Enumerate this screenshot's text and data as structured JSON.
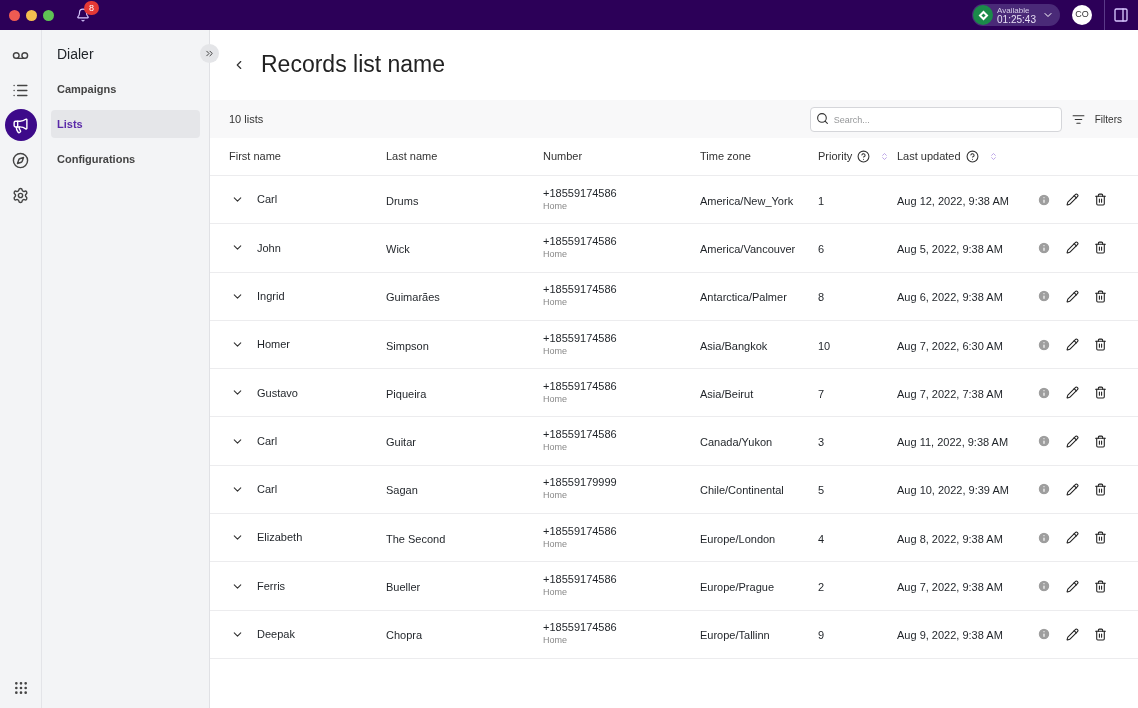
{
  "topbar": {
    "notifications": "8",
    "status": {
      "label": "Available",
      "timer": "01:25:43"
    },
    "avatar": "CO"
  },
  "rail": [
    {
      "selected": false
    },
    {
      "selected": false
    },
    {
      "selected": true
    },
    {
      "selected": false
    },
    {
      "selected": false
    }
  ],
  "sidebar": {
    "title": "Dialer",
    "items": [
      {
        "label": "Campaigns",
        "selected": false
      },
      {
        "label": "Lists",
        "selected": true
      },
      {
        "label": "Configurations",
        "selected": false
      }
    ]
  },
  "page": {
    "title": "Records list name",
    "count": "10 lists",
    "search": {
      "placeholder": "Search..."
    },
    "filters": "Filters"
  },
  "table": {
    "columns": [
      {
        "label": "First name"
      },
      {
        "label": "Last name"
      },
      {
        "label": "Number"
      },
      {
        "label": "Time zone"
      },
      {
        "label": "Priority",
        "help": true,
        "sortable": true
      },
      {
        "label": "Last updated",
        "help": true,
        "sortable": true
      }
    ],
    "rows": [
      {
        "first": "Carl",
        "last": "Drums",
        "number": "+18559174586",
        "number_type": "Home",
        "tz": "America/New_York",
        "priority": "1",
        "updated": "Aug 12, 2022, 9:38 AM"
      },
      {
        "first": "John",
        "last": "Wick",
        "number": "+18559174586",
        "number_type": "Home",
        "tz": "America/Vancouver",
        "priority": "6",
        "updated": "Aug 5, 2022, 9:38 AM"
      },
      {
        "first": "Ingrid",
        "last": "Guimarães",
        "number": "+18559174586",
        "number_type": "Home",
        "tz": "Antarctica/Palmer",
        "priority": "8",
        "updated": "Aug 6, 2022, 9:38 AM"
      },
      {
        "first": "Homer",
        "last": "Simpson",
        "number": "+18559174586",
        "number_type": "Home",
        "tz": "Asia/Bangkok",
        "priority": "10",
        "updated": "Aug 7, 2022, 6:30 AM"
      },
      {
        "first": "Gustavo",
        "last": "Piqueira",
        "number": "+18559174586",
        "number_type": "Home",
        "tz": "Asia/Beirut",
        "priority": "7",
        "updated": "Aug 7, 2022, 7:38 AM"
      },
      {
        "first": "Carl",
        "last": "Guitar",
        "number": "+18559174586",
        "number_type": "Home",
        "tz": "Canada/Yukon",
        "priority": "3",
        "updated": "Aug 11, 2022, 9:38 AM"
      },
      {
        "first": "Carl",
        "last": "Sagan",
        "number": "+18559179999",
        "number_type": "Home",
        "tz": "Chile/Continental",
        "priority": "5",
        "updated": "Aug 10, 2022, 9:39 AM"
      },
      {
        "first": "Elizabeth",
        "last": "The Second",
        "number": "+18559174586",
        "number_type": "Home",
        "tz": "Europe/London",
        "priority": "4",
        "updated": "Aug 8, 2022, 9:38 AM"
      },
      {
        "first": "Ferris",
        "last": "Bueller",
        "number": "+18559174586",
        "number_type": "Home",
        "tz": "Europe/Prague",
        "priority": "2",
        "updated": "Aug 7, 2022, 9:38 AM"
      },
      {
        "first": "Deepak",
        "last": "Chopra",
        "number": "+18559174586",
        "number_type": "Home",
        "tz": "Europe/Tallinn",
        "priority": "9",
        "updated": "Aug 9, 2022, 9:38 AM"
      }
    ]
  }
}
